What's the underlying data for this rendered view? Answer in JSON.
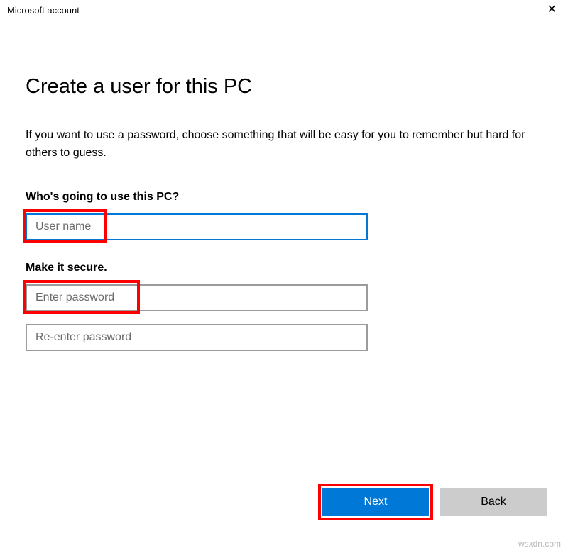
{
  "window": {
    "title": "Microsoft account"
  },
  "page": {
    "heading": "Create a user for this PC",
    "description": "If you want to use a password, choose something that will be easy for you to remember but hard for others to guess."
  },
  "sections": {
    "who": {
      "label": "Who's going to use this PC?",
      "username_placeholder": "User name"
    },
    "secure": {
      "label": "Make it secure.",
      "password_placeholder": "Enter password",
      "reenter_placeholder": "Re-enter password"
    }
  },
  "buttons": {
    "next": "Next",
    "back": "Back"
  },
  "watermark": "wsxdn.com",
  "colors": {
    "accent": "#0078d7",
    "highlight": "#ff0000",
    "secondary_button": "#cccccc"
  }
}
